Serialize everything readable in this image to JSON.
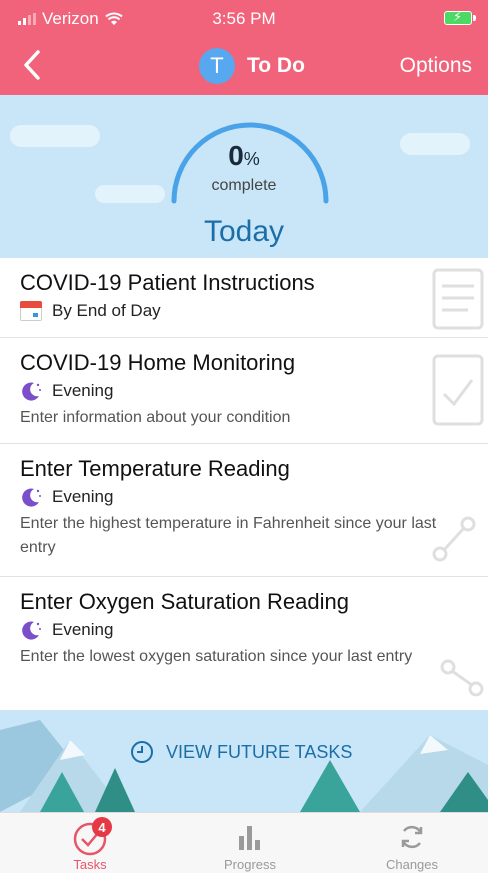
{
  "status_bar": {
    "carrier": "Verizon",
    "time": "3:56 PM"
  },
  "nav": {
    "avatar_letter": "T",
    "title": "To Do",
    "options_label": "Options"
  },
  "progress": {
    "percent": "0",
    "percent_sign": "%",
    "label": "complete"
  },
  "section_title": "Today",
  "tasks": [
    {
      "name": "COVID-19 Patient Instructions",
      "when": "By End of Day",
      "icon": "calendar-icon",
      "description": ""
    },
    {
      "name": "COVID-19 Home Monitoring",
      "when": "Evening",
      "icon": "moon-icon",
      "description": "Enter information about your condition"
    },
    {
      "name": "Enter Temperature Reading",
      "when": "Evening",
      "icon": "moon-icon",
      "description": "Enter the highest temperature in Fahrenheit since your last entry"
    },
    {
      "name": "Enter Oxygen Saturation Reading",
      "when": "Evening",
      "icon": "moon-icon",
      "description": "Enter the lowest oxygen saturation since your last entry"
    }
  ],
  "future_tasks_label": "VIEW FUTURE TASKS",
  "tabbar": {
    "tasks": {
      "label": "Tasks",
      "badge": "4"
    },
    "progress": {
      "label": "Progress"
    },
    "changes": {
      "label": "Changes"
    }
  },
  "colors": {
    "header": "#f0637a",
    "sky": "#c8e6f7",
    "accent": "#1b6ea8",
    "tab_active": "#e85468",
    "badge": "#e63946"
  }
}
